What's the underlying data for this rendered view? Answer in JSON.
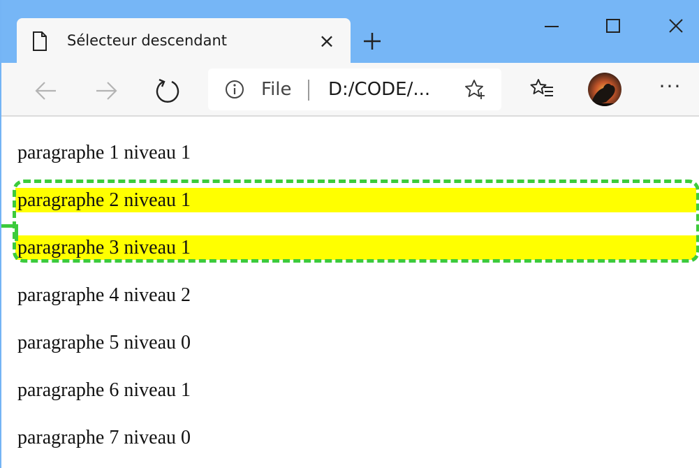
{
  "browser": {
    "tab": {
      "title": "Sélecteur descendant",
      "close_glyph": "×"
    },
    "address_bar": {
      "scheme_label": "File",
      "url": "D:/CODE/..."
    },
    "icons": {
      "page": "page-icon",
      "new_tab": "plus-icon",
      "minimize": "minimize-icon",
      "maximize": "maximize-icon",
      "close": "close-icon",
      "back": "arrow-left-icon",
      "forward": "arrow-right-icon",
      "reload": "reload-icon",
      "info": "info-icon",
      "favorite": "star-add-icon",
      "favorites": "favorites-icon",
      "more": "ellipsis-icon"
    },
    "more_glyph": "···",
    "colors": {
      "titlebar": "#76b6f6",
      "toolbar": "#f7f7f7"
    }
  },
  "page": {
    "paragraphs": [
      {
        "text": "paragraphe 1 niveau 1",
        "highlighted": false
      },
      {
        "text": "paragraphe 2 niveau 1",
        "highlighted": true
      },
      {
        "text": "paragraphe 3 niveau 1",
        "highlighted": true
      },
      {
        "text": "paragraphe 4 niveau 2",
        "highlighted": false
      },
      {
        "text": "paragraphe 5 niveau 0",
        "highlighted": false
      },
      {
        "text": "paragraphe 6 niveau 1",
        "highlighted": false
      },
      {
        "text": "paragraphe 7 niveau 0",
        "highlighted": false
      }
    ],
    "colors": {
      "highlight": "#ffff00",
      "annotation": "#3ccb3c"
    }
  }
}
